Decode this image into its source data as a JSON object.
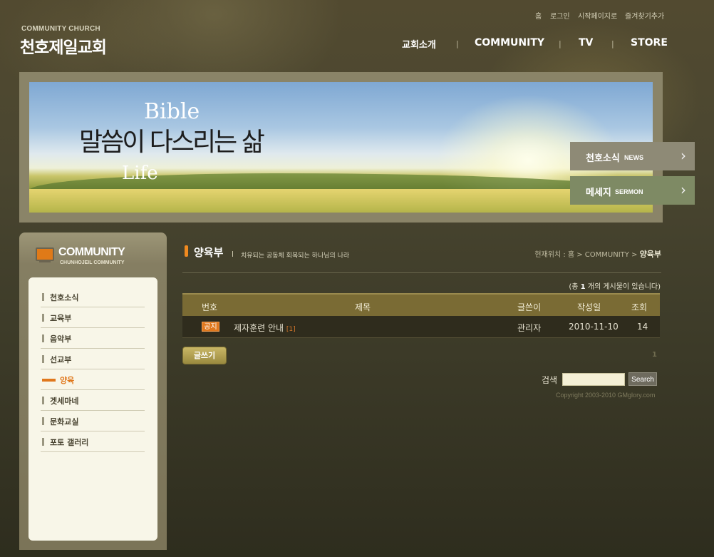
{
  "header": {
    "logo_sub": "COMMUNITY CHURCH",
    "logo_main": "천호제일교회",
    "util_links": [
      "홈",
      "로그인",
      "시작페이지로",
      "즐겨찾기추가"
    ],
    "nav": [
      "교회소개",
      "COMMUNITY",
      "TV",
      "STORE"
    ]
  },
  "banner": {
    "word_bible": "Bible",
    "word_life": "Life",
    "slogan": "말씀이 다스리는 삶",
    "quick_links": [
      {
        "label": "천호소식",
        "sub": "NEWS"
      },
      {
        "label": "메세지",
        "sub": "SERMON"
      }
    ]
  },
  "sidebar": {
    "title": "COMMUNITY",
    "subtitle": "CHUNHOJEIL COMMUNITY",
    "items": [
      "천호소식",
      "교육부",
      "음악부",
      "선교부",
      "양육",
      "겟세마네",
      "문화교실",
      "포토 갤러리"
    ],
    "active_index": 4
  },
  "content": {
    "title": "양육부",
    "description": "치유되는 공동체 회복되는 하나님의 나라",
    "location_prefix": "현재위치 : 홈 > COMMUNITY > ",
    "location_current": "양육부",
    "count_prefix": "(총 ",
    "count_value": "1",
    "count_suffix": " 개의 게시물이 있습니다)",
    "table": {
      "headers": [
        "번호",
        "제목",
        "글쓴이",
        "작성일",
        "조회"
      ],
      "rows": [
        {
          "badge": "공지",
          "title": "제자훈련 안내",
          "comments": "[1]",
          "author": "관리자",
          "date": "2010-11-10",
          "views": "14"
        }
      ]
    },
    "write_label": "글쓰기",
    "pages": [
      "1"
    ],
    "search_label": "검색",
    "search_value": "",
    "search_button": "Search",
    "copyright": "Copyright 2003-2010 GMglory.com"
  },
  "colors": {
    "accent": "#e0781d",
    "table_header": "#7a6b34",
    "background": "#3f3d2a"
  }
}
